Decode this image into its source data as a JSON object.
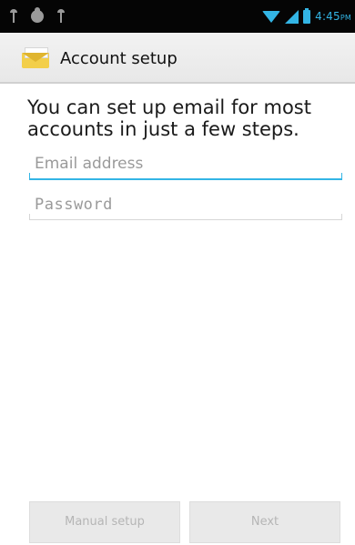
{
  "status_bar": {
    "time": "4:45",
    "time_suffix": "PM",
    "left_icons": [
      "usb-icon",
      "debug-icon",
      "usb-icon"
    ],
    "right_icons": [
      "wifi-icon",
      "signal-icon",
      "battery-icon"
    ],
    "accent_color": "#33b5e5"
  },
  "action_bar": {
    "icon": "email-envelope-icon",
    "title": "Account setup"
  },
  "main": {
    "instructions": "You can set up email for most accounts in just a few steps.",
    "email_field": {
      "placeholder": "Email address",
      "value": ""
    },
    "password_field": {
      "placeholder": "Password",
      "value": ""
    }
  },
  "buttons": {
    "manual_setup": "Manual setup",
    "next": "Next"
  }
}
